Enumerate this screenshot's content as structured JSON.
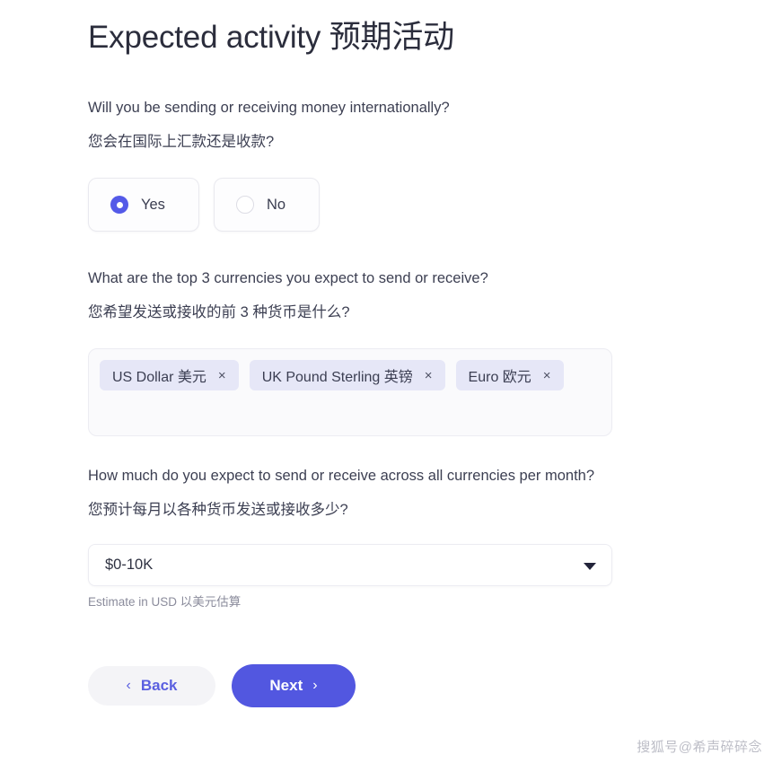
{
  "page": {
    "title": "Expected activity 预期活动"
  },
  "questions": {
    "q1": {
      "en": "Will you be sending or receiving money internationally?",
      "zh": "您会在国际上汇款还是收款?",
      "options": [
        {
          "label": "Yes",
          "selected": true
        },
        {
          "label": "No",
          "selected": false
        }
      ]
    },
    "q2": {
      "en": "What are the top 3 currencies you expect to send or receive?",
      "zh": "您希望发送或接收的前 3 种货币是什么?",
      "tags": [
        {
          "label": "US Dollar 美元",
          "remove": "×"
        },
        {
          "label": "UK Pound Sterling 英镑",
          "remove": "×"
        },
        {
          "label": "Euro 欧元",
          "remove": "×"
        }
      ]
    },
    "q3": {
      "en": "How much do you expect to send or receive across all currencies per month?",
      "zh": "您预计每月以各种货币发送或接收多少?",
      "select_value": "$0-10K",
      "helper": "Estimate in USD 以美元估算"
    }
  },
  "footer": {
    "back_label": "Back",
    "back_chevron": "‹",
    "next_label": "Next",
    "next_chevron": "›"
  },
  "watermark": "搜狐号@希声碎碎念",
  "colors": {
    "accent": "#5257e0",
    "radio_selected": "#545ae8",
    "tag_bg": "#e6e7f7",
    "back_bg": "#f4f4f7",
    "helper_text": "#8b8c9c"
  }
}
